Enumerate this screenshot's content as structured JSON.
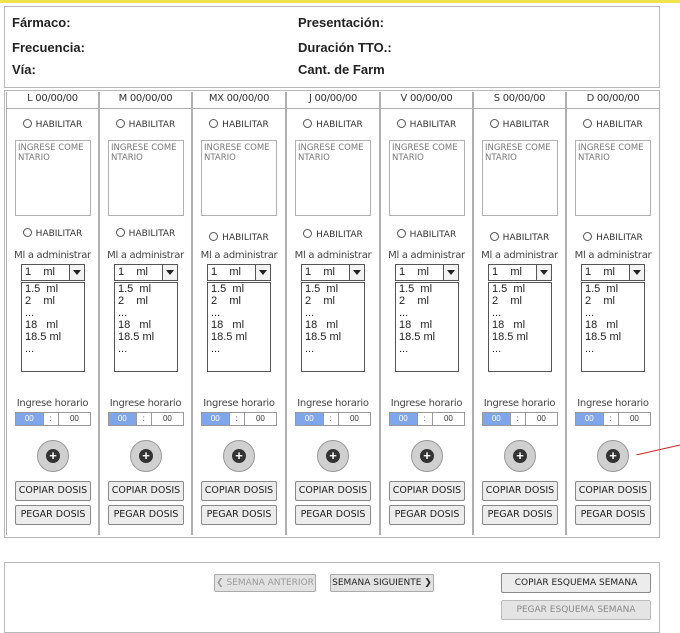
{
  "header": {
    "farmaco": "Fármaco:",
    "presentacion": "Presentación:",
    "frecuencia": "Frecuencia:",
    "duracion": "Duración TTO.:",
    "via": "Vía:",
    "cant_farm": "Cant. de Farm"
  },
  "days": [
    {
      "header": "L 00/00/00"
    },
    {
      "header": "M 00/00/00"
    },
    {
      "header": "MX 00/00/00"
    },
    {
      "header": "J 00/00/00"
    },
    {
      "header": "V 00/00/00"
    },
    {
      "header": "S 00/00/00"
    },
    {
      "header": "D 00/00/00"
    }
  ],
  "day_common": {
    "habilitar": "HABILITAR",
    "comment_placeholder": "INGRESE COMENTARIO",
    "ml_label": "Ml a administrar",
    "select_value": "1    ml",
    "options": [
      "1.5  ml",
      "2    ml",
      "...",
      "18   ml",
      "18.5 ml",
      "..."
    ],
    "horario_label": "Ingrese horario",
    "hh": "00",
    "sep": ":",
    "mm": "00",
    "copy_label": "COPIAR DOSIS",
    "paste_label": "PEGAR DOSIS"
  },
  "footer": {
    "prev_week": "SEMANA ANTERIOR",
    "next_week": "SEMANA SIGUIENTE",
    "copy_schema": "COPIAR ESQUEMA SEMANA",
    "paste_schema": "PEGAR ESQUEMA SEMANA"
  },
  "colors": {
    "top_accent": "#f2e24a",
    "hour_highlight": "#7fa6ea",
    "annotation_line": "#cc2222"
  }
}
